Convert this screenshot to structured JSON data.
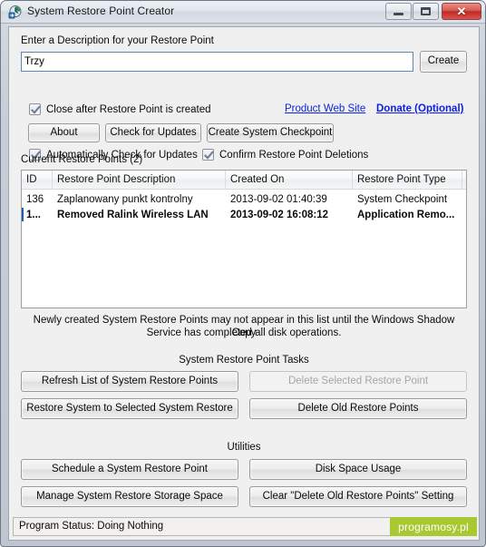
{
  "window": {
    "title": "System Restore Point Creator",
    "icon": "clock-restore-icon",
    "controls": {
      "minimize": "minimize-button",
      "maximize": "maximize-button",
      "close": "close-button",
      "close_glyph": "✕"
    }
  },
  "form": {
    "description_label": "Enter a Description for your Restore Point",
    "description_value": "Trzy",
    "description_placeholder": "",
    "create_label": "Create"
  },
  "options": {
    "close_after": {
      "label": "Close after Restore Point is created",
      "checked": true
    },
    "auto_check": {
      "label": "Automatically Check for Updates",
      "checked": true
    },
    "confirm_delete": {
      "label": "Confirm Restore Point Deletions",
      "checked": true
    }
  },
  "links": {
    "product_site": "Product Web Site",
    "donate": "Donate (Optional)"
  },
  "toolbar": {
    "about": "About",
    "check_updates": "Check for Updates",
    "create_checkpoint": "Create System Checkpoint"
  },
  "list": {
    "caption": "Current Restore Points (2)",
    "columns": [
      "ID",
      "Restore Point Description",
      "Created On",
      "Restore Point Type"
    ],
    "rows": [
      {
        "id": "136",
        "description": "Zaplanowany punkt kontrolny",
        "created_on": "2013-09-02 01:40:39",
        "type": "System Checkpoint",
        "selected": false
      },
      {
        "id": "1...",
        "description": "Removed Ralink Wireless LAN",
        "created_on": "2013-09-02 16:08:12",
        "type": "Application Remo...",
        "selected": true
      }
    ]
  },
  "note": {
    "line1": "Newly created System Restore Points may not appear in this list until the Windows Shadow Copy",
    "line2": "Service has completed all disk operations."
  },
  "tasks": {
    "caption": "System Restore Point Tasks",
    "refresh": "Refresh List of System Restore Points",
    "delete_selected": "Delete Selected Restore Point",
    "delete_selected_enabled": false,
    "restore_system": "Restore System to Selected System Restore",
    "delete_old": "Delete Old Restore Points"
  },
  "utilities": {
    "caption": "Utilities",
    "schedule": "Schedule a System Restore Point",
    "disk_space": "Disk Space Usage",
    "manage_storage": "Manage System Restore Storage Space",
    "clear_setting": "Clear \"Delete Old Restore Points\" Setting"
  },
  "status": {
    "text": "Program Status:  Doing Nothing",
    "watermark": "programosy.pl",
    "watermark_color": "#a8c932"
  }
}
